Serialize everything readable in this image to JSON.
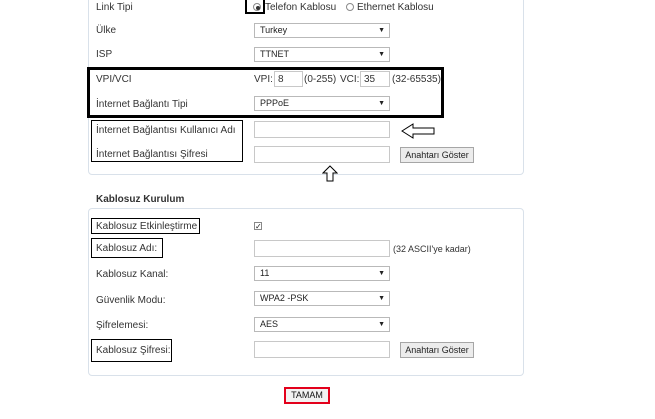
{
  "connection": {
    "link_type_label": "Link Tipi",
    "link_options": [
      "Telefon Kablosu",
      "Ethernet Kablosu"
    ],
    "link_selected": 0,
    "country_label": "Ülke",
    "country_value": "Turkey",
    "isp_label": "ISP",
    "isp_value": "TTNET",
    "vpivci_label": "VPI/VCI",
    "vpi_label": "VPI:",
    "vpi_value": "8",
    "vpi_range": "(0-255)",
    "vci_label": "VCI:",
    "vci_value": "35",
    "vci_range": "(32-65535)",
    "conn_type_label": "İnternet Bağlantı Tipi",
    "conn_type_value": "PPPoE",
    "username_label": "İnternet Bağlantısı Kullanıcı Adı",
    "username_value": "",
    "password_label": "İnternet Bağlantısı Şifresi",
    "password_value": "",
    "show_key_label": "Anahtarı Göster"
  },
  "wireless": {
    "title": "Kablosuz Kurulum",
    "enable_label": "Kablosuz Etkinleştirme",
    "enable_checked": true,
    "ssid_label": "Kablosuz Adı:",
    "ssid_value": "",
    "ssid_hint": "(32 ASCII'ye kadar)",
    "channel_label": "Kablosuz Kanal:",
    "channel_value": "11",
    "security_label": "Güvenlik Modu:",
    "security_value": "WPA2 -PSK",
    "encryption_label": "Şifrelemesi:",
    "encryption_value": "AES",
    "key_label": "Kablosuz Şifresi:",
    "key_value": "",
    "show_key_label": "Anahtarı Göster"
  },
  "actions": {
    "ok_label": "TAMAM"
  },
  "icons": [
    "chevron-down-icon",
    "arrow-left-icon",
    "arrow-up-icon",
    "checkmark-icon"
  ]
}
